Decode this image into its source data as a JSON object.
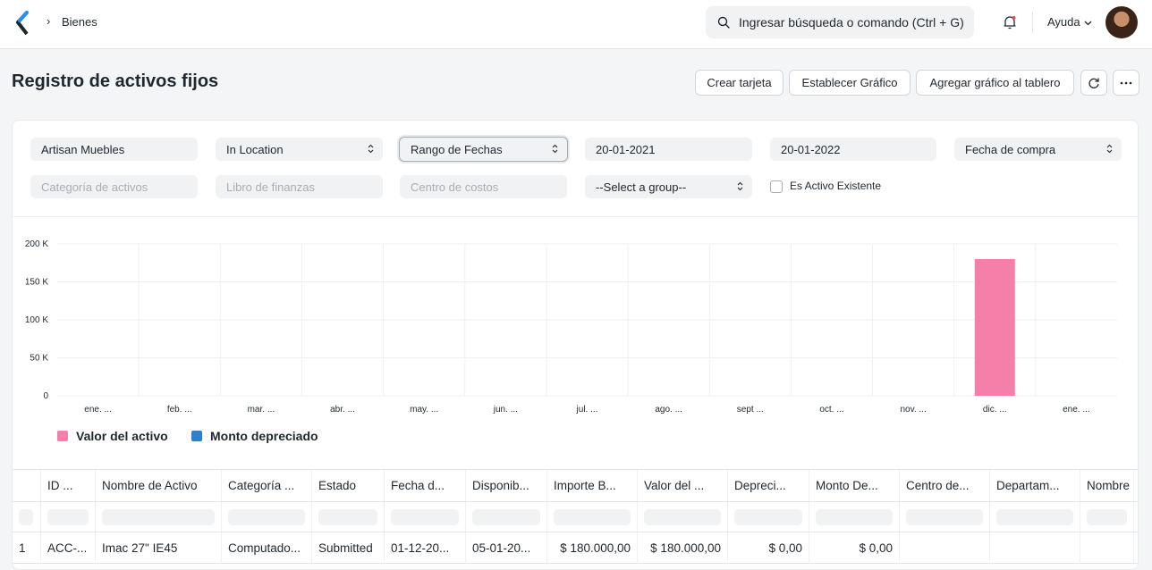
{
  "navbar": {
    "breadcrumb": "Bienes",
    "breadcrumb_sep": "›",
    "search_placeholder": "Ingresar búsqueda o comando (Ctrl + G)",
    "help_label": "Ayuda"
  },
  "page": {
    "title": "Registro de activos fijos",
    "buttons": {
      "create_card": "Crear tarjeta",
      "set_chart": "Establecer Gráfico",
      "add_to_dashboard": "Agregar gráfico al tablero"
    }
  },
  "filters": {
    "company": "Artisan Muebles",
    "status": "In Location",
    "filter_based_on": "Rango de Fechas",
    "from_date": "20-01-2021",
    "to_date": "20-01-2022",
    "date_based_on": "Fecha de compra",
    "asset_category_placeholder": "Categoría de activos",
    "finance_book_placeholder": "Libro de finanzas",
    "cost_center_placeholder": "Centro de costos",
    "group_by": "--Select a group--",
    "is_existing_label": "Es Activo Existente"
  },
  "chart_data": {
    "type": "bar",
    "categories": [
      "ene. ...",
      "feb. ...",
      "mar. ...",
      "abr. ...",
      "may. ...",
      "jun. ...",
      "jul. ...",
      "ago. ...",
      "sept ...",
      "oct. ...",
      "nov. ...",
      "dic. ...",
      "ene. ..."
    ],
    "series": [
      {
        "name": "Valor del activo",
        "color": "#f47fa8",
        "values": [
          0,
          0,
          0,
          0,
          0,
          0,
          0,
          0,
          0,
          0,
          0,
          180000,
          0
        ]
      },
      {
        "name": "Monto depreciado",
        "color": "#2f7fcf",
        "values": [
          0,
          0,
          0,
          0,
          0,
          0,
          0,
          0,
          0,
          0,
          0,
          0,
          0
        ]
      }
    ],
    "ylim": [
      0,
      200000
    ],
    "y_ticks": [
      0,
      50000,
      100000,
      150000,
      200000
    ],
    "y_tick_labels": [
      "0",
      "50 K",
      "100 K",
      "150 K",
      "200 K"
    ],
    "grid": true,
    "legend_position": "bottom-left"
  },
  "table": {
    "columns": [
      "",
      "ID ...",
      "Nombre de Activo",
      "Categoría ...",
      "Estado",
      "Fecha d...",
      "Disponib...",
      "Importe B...",
      "Valor del ...",
      "Depreci...",
      "Monto De...",
      "Centro de...",
      "Departam...",
      "Nombre d"
    ],
    "rows": [
      [
        "1",
        "ACC-...",
        "Imac 27\" IE45",
        "Computado...",
        "Submitted",
        "01-12-20...",
        "05-01-20...",
        "$ 180.000,00",
        "$ 180.000,00",
        "$ 0,00",
        "$ 0,00",
        "",
        "",
        ""
      ]
    ]
  }
}
